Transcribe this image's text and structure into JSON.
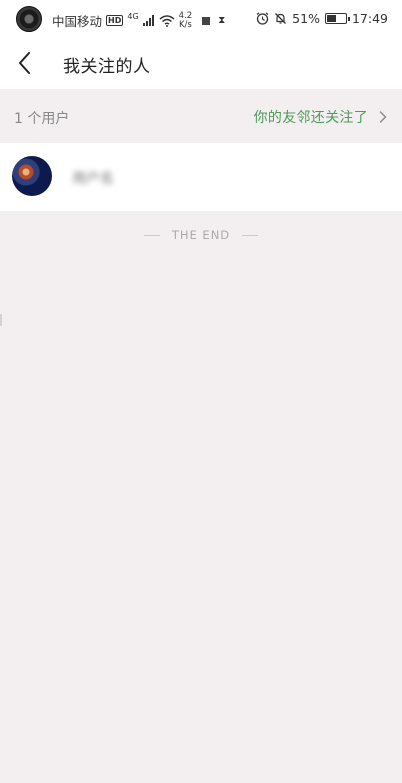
{
  "status_bar": {
    "carrier": "中国移动",
    "hd": "HD",
    "network": "4G",
    "speed_value": "4.2",
    "speed_unit": "K/s",
    "battery_percent": "51%",
    "battery_level": 0.51,
    "time": "17:49"
  },
  "header": {
    "title": "我关注的人",
    "back_icon": "chevron-left-icon"
  },
  "section": {
    "user_count": "1 个用户",
    "friends_link": "你的友邻还关注了"
  },
  "users": [
    {
      "name": "用户名"
    }
  ],
  "footer": {
    "end_text": "THE END"
  },
  "colors": {
    "background": "#f3eff0",
    "accent_green": "#4d9a5a",
    "muted_text": "#888888"
  }
}
